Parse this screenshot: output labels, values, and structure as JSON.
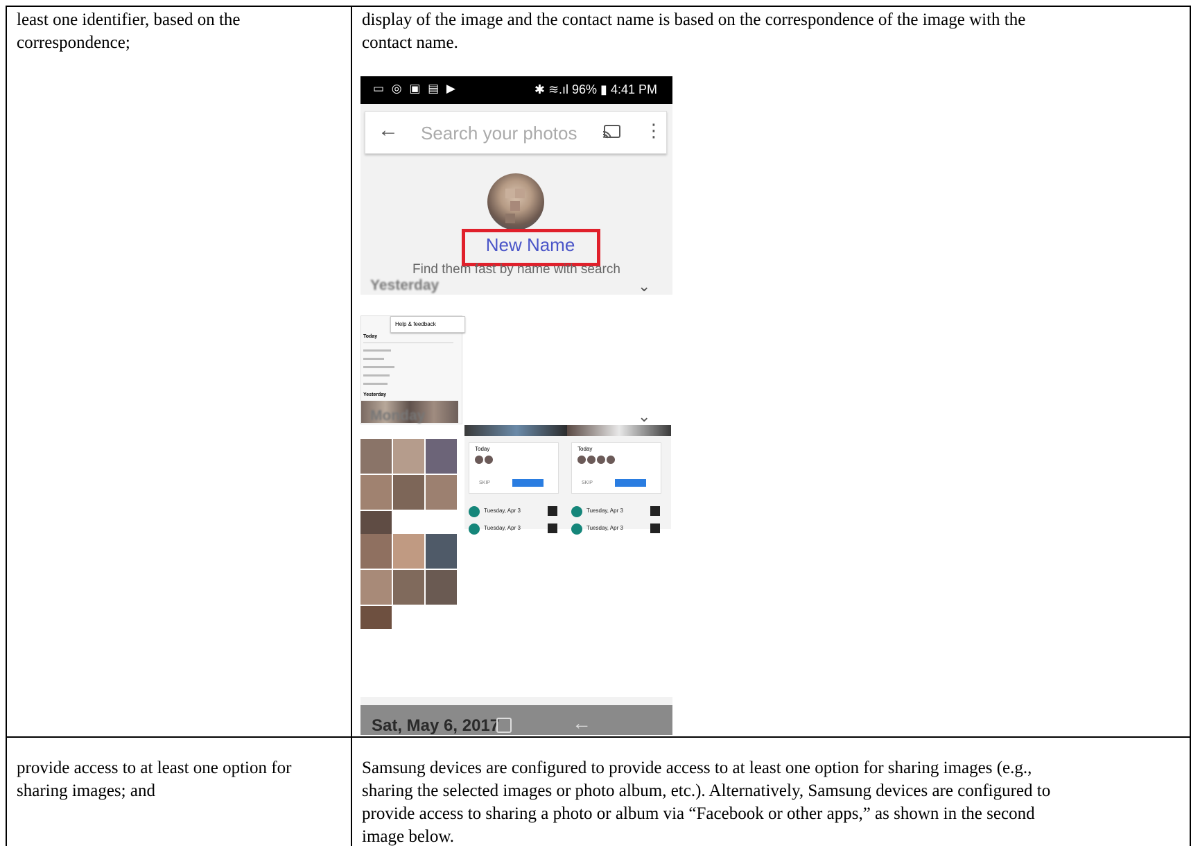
{
  "rows": [
    {
      "left": [
        "least one identifier, based on the",
        "correspondence;"
      ],
      "right": [
        "display of the image and the contact name is based on the correspondence of the image with the",
        "contact name."
      ]
    },
    {
      "left": [
        "provide access to at least one option for",
        "sharing images; and"
      ],
      "right": [
        "Samsung devices are configured to provide access to at least one option for sharing images (e.g.,",
        "sharing the selected images or photo album, etc.). Alternatively, Samsung devices are configured to",
        "provide access to sharing a photo or album via “Facebook or other apps,” as shown in the second",
        "image below."
      ]
    }
  ],
  "phone": {
    "status_left_icons": "▭ ◎ ▣ ▤ ▶",
    "status_right": "✱ ≋.ıl 96% ▮ 4:41 PM",
    "search_placeholder": "Search your photos",
    "contact_name": "New Name",
    "hint": "Find them fast by name with search",
    "sections": [
      {
        "title": "Yesterday"
      },
      {
        "title": "Monday"
      }
    ],
    "mini_menu": "Help & feedback",
    "mini_labels": [
      "Today",
      "Yesterday"
    ],
    "cards": [
      {
        "today": "Today",
        "row1": "Tuesday, Apr 3",
        "row2": "Tuesday, Apr 3"
      },
      {
        "today": "Today",
        "row1": "Tuesday, Apr 3",
        "row2": "Tuesday, Apr 3"
      }
    ],
    "bottom_date": "Sat, May 6, 2017"
  },
  "icons": {
    "search_back": "back-arrow-icon",
    "cast": "cast-icon",
    "more": "more-vert-icon",
    "chevron": "chevron-down-icon",
    "recent_apps": "recent-apps-icon",
    "nav_back": "nav-back-icon"
  },
  "colors": {
    "highlight_box": "#e0202b",
    "contact_name": "#4a55c8",
    "review_button": "#2a7de1",
    "avatar_teal": "#15867a"
  }
}
